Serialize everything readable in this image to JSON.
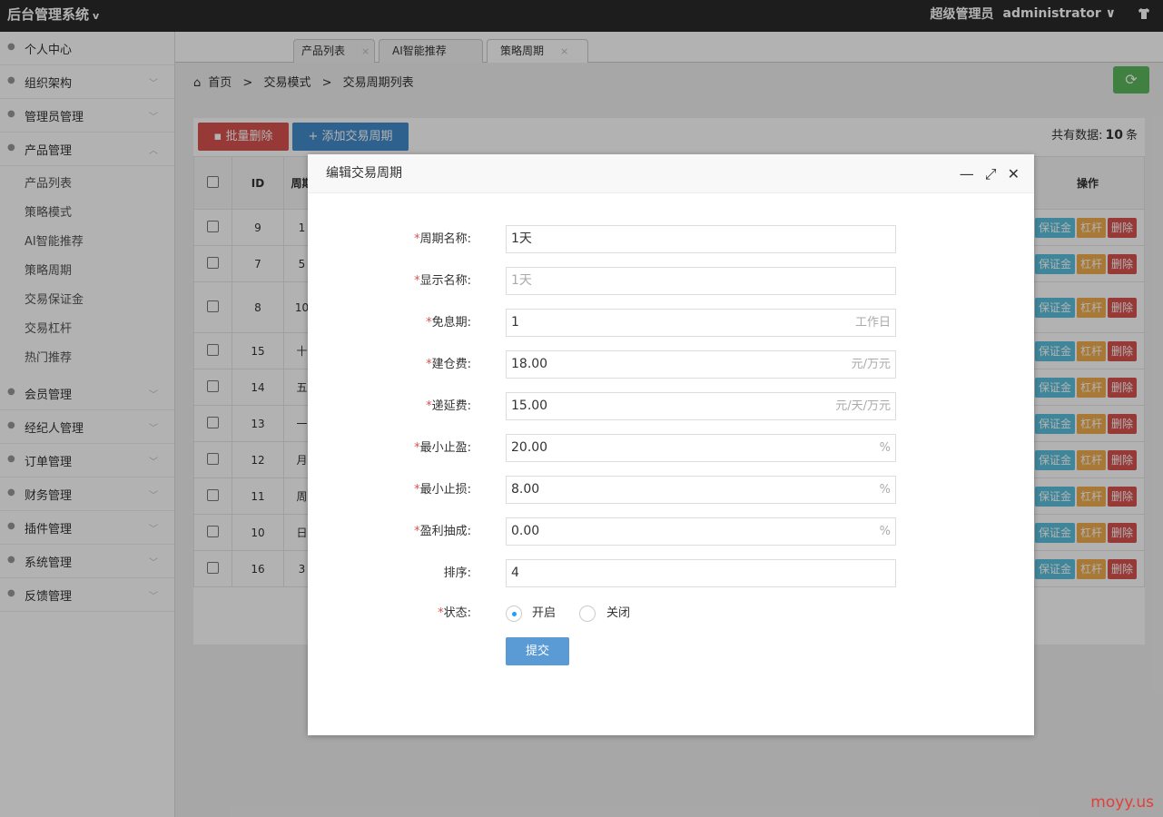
{
  "header": {
    "brand": "后台管理系统",
    "brand_caret": "v",
    "user_role": "超级管理员",
    "username": "administrator",
    "user_caret": "∨"
  },
  "sidebar": {
    "items": [
      {
        "label": "个人中心",
        "icon": "user-icon",
        "chev": ""
      },
      {
        "label": "组织架构",
        "icon": "org-icon",
        "chev": "﹀"
      },
      {
        "label": "管理员管理",
        "icon": "admin-icon",
        "chev": "﹀"
      },
      {
        "label": "产品管理",
        "icon": "box-icon",
        "chev": "︿"
      }
    ],
    "sub_items": [
      "产品列表",
      "策略模式",
      "AI智能推荐",
      "策略周期",
      "交易保证金",
      "交易杠杆",
      "热门推荐"
    ],
    "items_after": [
      {
        "label": "会员管理",
        "icon": "member-icon"
      },
      {
        "label": "经纪人管理",
        "icon": "broker-icon"
      },
      {
        "label": "订单管理",
        "icon": "order-icon"
      },
      {
        "label": "财务管理",
        "icon": "finance-icon"
      },
      {
        "label": "插件管理",
        "icon": "plugin-icon"
      },
      {
        "label": "系统管理",
        "icon": "gear-icon"
      },
      {
        "label": "反馈管理",
        "icon": "feedback-icon"
      }
    ]
  },
  "tabs": [
    {
      "label": "产品列表",
      "close": "×"
    },
    {
      "label": "AI智能推荐",
      "close": "×"
    },
    {
      "label": "策略周期",
      "close": "×"
    }
  ],
  "breadcrumb": {
    "home": "首页",
    "sep": ">",
    "level1": "交易模式",
    "level2": "交易周期列表"
  },
  "toolbar": {
    "batch_delete": "批量删除",
    "add": "添加交易周期",
    "count_prefix": "共有数据:",
    "count": "10",
    "count_suffix": "条"
  },
  "table": {
    "headers": {
      "id": "ID",
      "col3": "周期",
      "actions": "操作"
    },
    "rows": [
      {
        "id": "9",
        "c3": "1"
      },
      {
        "id": "7",
        "c3": "5"
      },
      {
        "id": "8",
        "c3": "10"
      },
      {
        "id": "15",
        "c3": "十"
      },
      {
        "id": "14",
        "c3": "五"
      },
      {
        "id": "13",
        "c3": "一"
      },
      {
        "id": "12",
        "c3": "月"
      },
      {
        "id": "11",
        "c3": "周"
      },
      {
        "id": "10",
        "c3": "日"
      },
      {
        "id": "16",
        "c3": "3"
      }
    ],
    "action_labels": {
      "margin": "保证金",
      "lever": "杠杆",
      "delete": "删除"
    }
  },
  "dialog": {
    "title": "编辑交易周期",
    "fields": [
      {
        "label": "周期名称:",
        "value": "1天",
        "suffix": "",
        "required": true,
        "placeholder": false
      },
      {
        "label": "显示名称:",
        "value": "1天",
        "suffix": "",
        "required": true,
        "placeholder": true
      },
      {
        "label": "免息期:",
        "value": "1",
        "suffix": "工作日",
        "required": true,
        "placeholder": false
      },
      {
        "label": "建仓费:",
        "value": "18.00",
        "suffix": "元/万元",
        "required": true,
        "placeholder": false
      },
      {
        "label": "递延费:",
        "value": "15.00",
        "suffix": "元/天/万元",
        "required": true,
        "placeholder": false
      },
      {
        "label": "最小止盈:",
        "value": "20.00",
        "suffix": "%",
        "required": true,
        "placeholder": false
      },
      {
        "label": "最小止损:",
        "value": "8.00",
        "suffix": "%",
        "required": true,
        "placeholder": false
      },
      {
        "label": "盈利抽成:",
        "value": "0.00",
        "suffix": "%",
        "required": true,
        "placeholder": false
      },
      {
        "label": "排序:",
        "value": "4",
        "suffix": "",
        "required": false,
        "placeholder": false
      }
    ],
    "status_label": "状态:",
    "status_on": "开启",
    "status_off": "关闭",
    "submit": "提交"
  },
  "watermark": "moyy.us",
  "colors": {
    "danger": "#d9534f",
    "primary": "#428bca",
    "success": "#5cb85c",
    "warning": "#f0ad4e",
    "info": "#5bc0de"
  }
}
